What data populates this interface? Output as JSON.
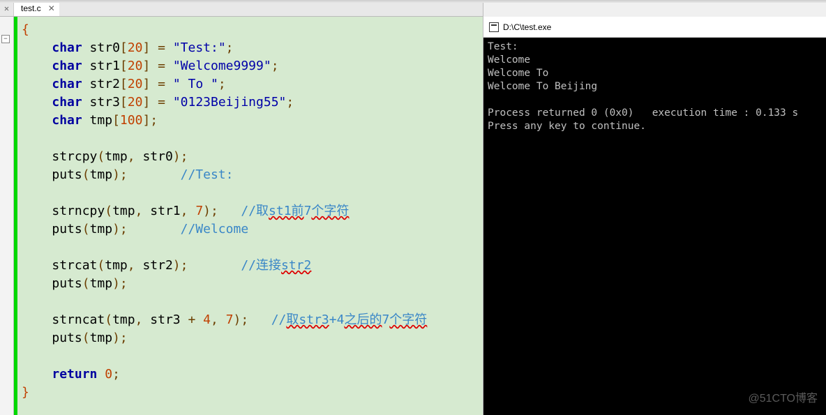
{
  "tab": {
    "filename": "test.c",
    "close_glyph_left": "✕",
    "close_glyph": "✕"
  },
  "fold_icon_glyph": "−",
  "code": {
    "brace_open": "{",
    "l1": {
      "kw": "char",
      "var": " str0",
      "brk1": "[",
      "num": "20",
      "brk2": "]",
      "sp": " ",
      "eq": "=",
      "sp2": " ",
      "str": "\"Test:\"",
      "semi": ";"
    },
    "l2": {
      "kw": "char",
      "var": " str1",
      "brk1": "[",
      "num": "20",
      "brk2": "]",
      "sp": " ",
      "eq": "=",
      "sp2": " ",
      "str": "\"Welcome9999\"",
      "semi": ";"
    },
    "l3": {
      "kw": "char",
      "var": " str2",
      "brk1": "[",
      "num": "20",
      "brk2": "]",
      "sp": " ",
      "eq": "=",
      "sp2": " ",
      "str": "\" To \"",
      "semi": ";"
    },
    "l4": {
      "kw": "char",
      "var": " str3",
      "brk1": "[",
      "num": "20",
      "brk2": "]",
      "sp": " ",
      "eq": "=",
      "sp2": " ",
      "str": "\"0123Beijing55\"",
      "semi": ";"
    },
    "l5": {
      "kw": "char",
      "var": " tmp",
      "brk1": "[",
      "num": "100",
      "brk2": "]",
      "semi": ";"
    },
    "l6": {
      "fn": "strcpy",
      "op": "(",
      "a1": "tmp",
      "c": ",",
      "sp": " ",
      "a2": "str0",
      "cp": ")",
      "semi": ";"
    },
    "l7": {
      "fn": "puts",
      "op": "(",
      "a1": "tmp",
      "cp": ")",
      "semi": ";",
      "pad": "       ",
      "cmt": "//Test:"
    },
    "l8": {
      "fn": "strncpy",
      "op": "(",
      "a1": "tmp",
      "c1": ",",
      "sp1": " ",
      "a2": "str1",
      "c2": ",",
      "sp2": " ",
      "n": "7",
      "cp": ")",
      "semi": ";",
      "pad": "   ",
      "cmt_pre": "//取",
      "cmt_u1": "st1前",
      "cmt_mid": "7",
      "cmt_u2": "个字符"
    },
    "l9": {
      "fn": "puts",
      "op": "(",
      "a1": "tmp",
      "cp": ")",
      "semi": ";",
      "pad": "       ",
      "cmt": "//Welcome"
    },
    "l10": {
      "fn": "strcat",
      "op": "(",
      "a1": "tmp",
      "c": ",",
      "sp": " ",
      "a2": "str2",
      "cp": ")",
      "semi": ";",
      "pad": "       ",
      "cmt_pre": "//连接",
      "cmt_u": "str2"
    },
    "l11": {
      "fn": "puts",
      "op": "(",
      "a1": "tmp",
      "cp": ")",
      "semi": ";"
    },
    "l12": {
      "fn": "strncat",
      "op": "(",
      "a1": "tmp",
      "c1": ",",
      "sp1": " ",
      "a2": "str3 ",
      "plus": "+",
      "sp2": " ",
      "n1": "4",
      "c2": ",",
      "sp3": " ",
      "n2": "7",
      "cp": ")",
      "semi": ";",
      "pad": "   ",
      "cmt_pre": "//",
      "cmt_u1": "取str3",
      "cmt_mid": "+4",
      "cmt_u2": "之后的",
      "cmt_mid2": "7",
      "cmt_u3": "个字符"
    },
    "l13": {
      "fn": "puts",
      "op": "(",
      "a1": "tmp",
      "cp": ")",
      "semi": ";"
    },
    "l14": {
      "kw": "return",
      "sp": " ",
      "num": "0",
      "semi": ";"
    },
    "brace_close": "}"
  },
  "console": {
    "title": "D:\\C\\test.exe",
    "out1": "Test:",
    "out2": "Welcome",
    "out3": "Welcome To",
    "out4": "Welcome To Beijing",
    "blank": "",
    "proc": "Process returned 0 (0x0)   execution time : 0.133 s",
    "press": "Press any key to continue."
  },
  "watermark": "@51CTO博客"
}
